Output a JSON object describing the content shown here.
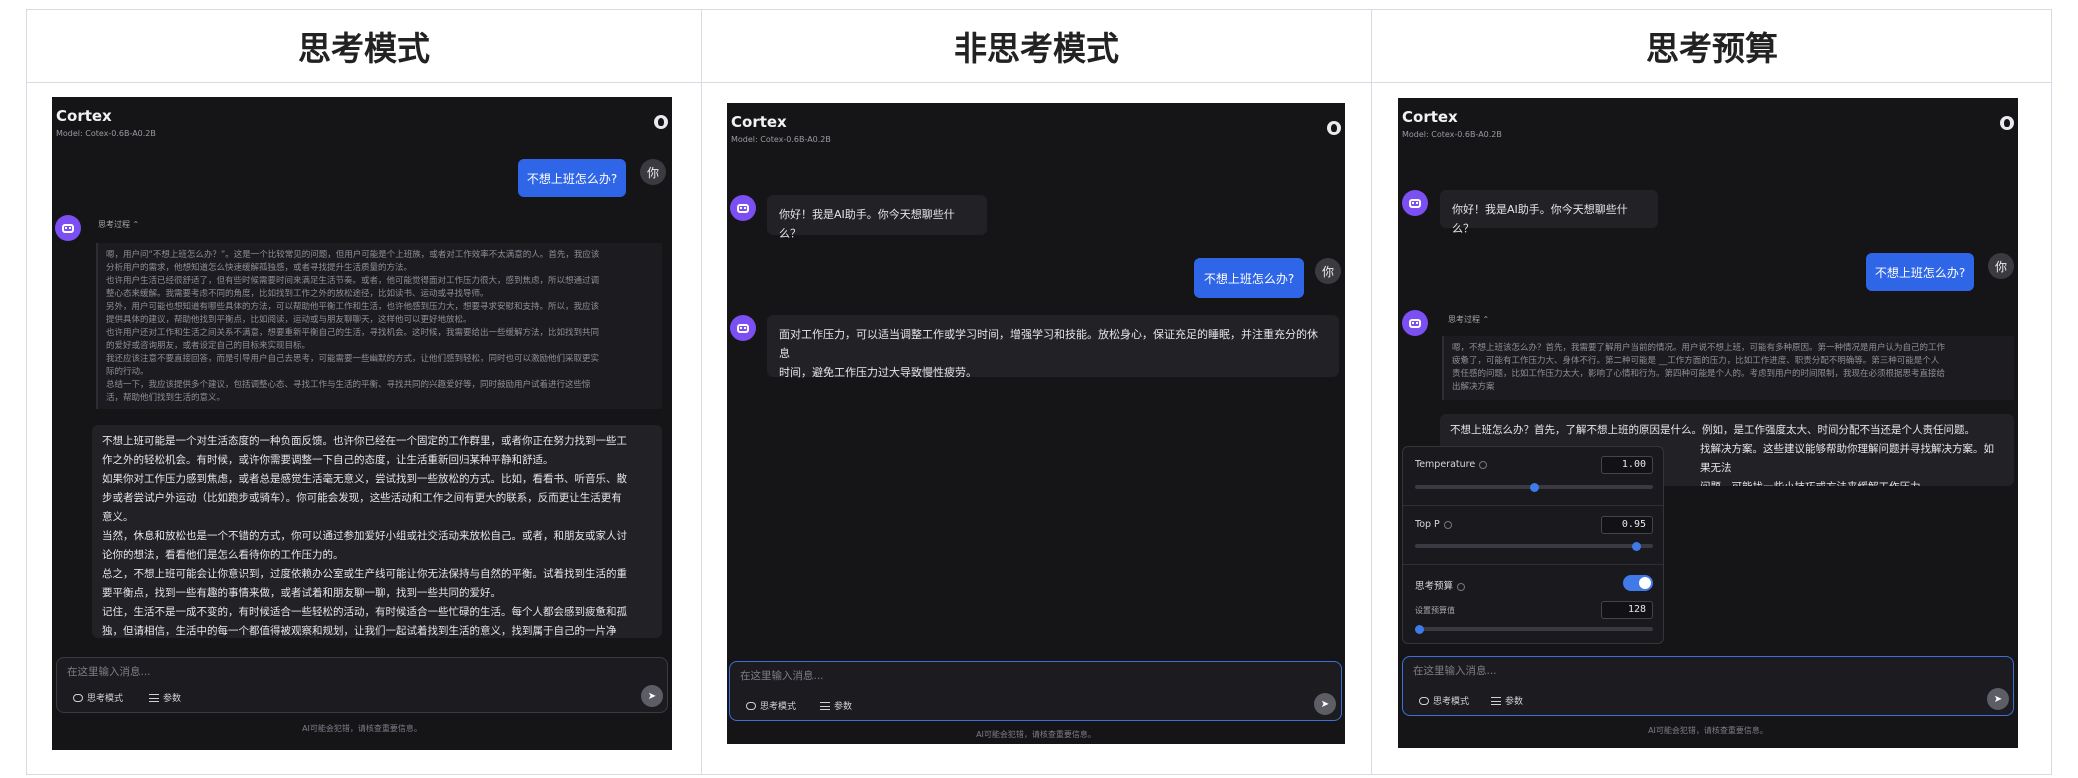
{
  "columns": {
    "col1": "思考模式",
    "col2": "非思考模式",
    "col3": "思考预算"
  },
  "app": {
    "brand": "Cortex",
    "model": "Model: Cotex-0.6B-A0.2B",
    "user_avatar": "你",
    "input_placeholder": "在这里输入消息...",
    "think_mode": "思考模式",
    "params": "参数",
    "disclaimer": "AI可能会犯错，请核查重要信息。",
    "think_process": "思考过程"
  },
  "panel1": {
    "user_msg": "不想上班怎么办?",
    "thinking": [
      "嗯，用户问“不想上班怎么办？”。这是一个比较常见的问题，但用户可能是个上班族，或者对工作效率不太满意的人。首先，我应该",
      "分析用户的需求，他想知道怎么快速缓解孤独感，或者寻找提升生活质量的方法。",
      "也许用户生活已经很舒适了，但有些时候需要时间来满足生活节奏。或者，他可能觉得面对工作压力很大，感到焦虑，所以想通过调",
      "整心态来缓解。我需要考虑不同的角度，比如找到工作之外的放松途径，比如读书、运动或寻找导师。",
      "另外，用户可能也想知道有哪些具体的方法，可以帮助他平衡工作和生活，也许他感到压力大，想要寻求安慰和支持。所以，我应该",
      "提供具体的建议，帮助他找到平衡点，比如阅读，运动或与朋友聊聊天，这样他可以更好地放松。",
      "也许用户还对工作和生活之间关系不满意，想要重新平衡自己的生活，寻找机会。这时候，我需要给出一些缓解方法，比如找到共同",
      "的爱好或咨询朋友，或者设定自己的目标来实现目标。",
      "我还应该注意不要直接回答，而是引导用户自己去思考，可能需要一些幽默的方式，让他们感到轻松，同时也可以激励他们采取更实",
      "际的行动。",
      "总结一下，我应该提供多个建议，包括调整心态、寻找工作与生活的平衡、寻找共同的兴趣爱好等，同时鼓励用户试着进行这些惊",
      "活，帮助他们找到生活的意义。"
    ],
    "answer": [
      "不想上班可能是一个对生活态度的一种负面反馈。也许你已经在一个固定的工作群里，或者你正在努力找到一些工",
      "作之外的轻松机会。有时候，或许你需要调整一下自己的态度，让生活重新回归某种平静和舒适。",
      "如果你对工作压力感到焦虑，或者总是感觉生活毫无意义，尝试找到一些放松的方式。比如，看看书、听音乐、散",
      "步或者尝试户外运动（比如跑步或骑车）。你可能会发现，这些活动和工作之间有更大的联系，反而更让生活更有",
      "意义。",
      "当然，休息和放松也是一个不错的方式，你可以通过参加爱好小组或社交活动来放松自己。或者，和朋友或家人讨",
      "论你的想法，看看他们是怎么看待你的工作压力的。",
      "总之，不想上班可能会让你意识到，过度依赖办公室或生产线可能让你无法保持与自然的平衡。试着找到生活的重",
      "要平衡点，找到一些有趣的事情来做，或者试着和朋友聊一聊，找到一些共同的爱好。",
      "记住，生活不是一成不变的，有时候适合一些轻松的活动，有时候适合一些忙碌的生活。每个人都会感到疲惫和孤",
      "独，但请相信，生活中的每一个都值得被观察和规划，让我们一起试着找到生活的意义，找到属于自己的一片净"
    ]
  },
  "panel2": {
    "greeting": "你好！我是AI助手。你今天想聊些什么？",
    "user_msg": "不想上班怎么办?",
    "answer": [
      "面对工作压力，可以适当调整工作或学习时间，增强学习和技能。放松身心，保证充足的睡眠，并注重充分的休息",
      "时间，避免工作压力过大导致慢性疲劳。"
    ]
  },
  "panel3": {
    "greeting": "你好！我是AI助手。你今天想聊些什么？",
    "user_msg": "不想上班怎么办?",
    "thinking": [
      "嗯，不想上班该怎么办？首先，我需要了解用户当前的情况。用户说不想上班，可能有多种原因。第一种情况是用户认为自己的工作",
      "疲惫了，可能有工作压力大、身体不行。第二种可能是 __工作方面的压力，比如工作进度、职责分配不明确等。第三种可能是个人",
      "责任感的问题，比如工作压力太大，影响了心情和行为。第四种可能是个人的。考虑到用户的时间限制，我现在必须根据思考直接给",
      "出解决方案"
    ],
    "answer": [
      "不想上班怎么办？首先，了解不想上班的原因是什么。例如，是工作强度太大、时间分配不当还是个人责任问题。",
      "找解决方案。这些建议能够帮助你理解问题并寻找解决方案。如果无法",
      "问题，可能找一些小技巧或方法来缓解工作压力。"
    ],
    "param_panel": {
      "temperature_label": "Temperature",
      "temperature_value": "1.00",
      "temperature_level": 0.5,
      "topp_label": "Top P",
      "topp_value": "0.95",
      "topp_level": 0.93,
      "budget_label": "思考预算",
      "budget_enabled": true,
      "budget_sub": "设置预算值",
      "budget_value": "128",
      "budget_level": 0.02
    }
  },
  "colors": {
    "accent": "#2f66e8",
    "bot_avatar": "#7b4ff2",
    "panel_bg": "#151518"
  }
}
